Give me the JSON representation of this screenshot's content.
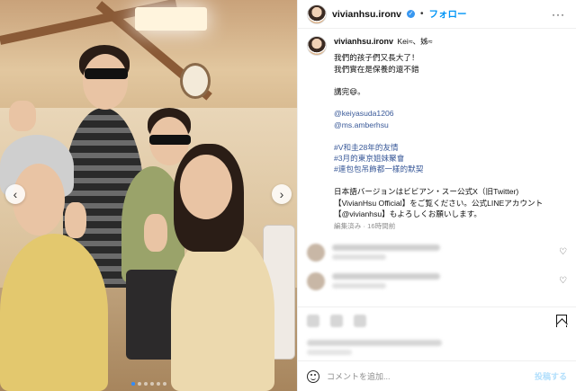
{
  "header": {
    "username": "vivianhsu.ironv",
    "separator": "•",
    "follow_label": "フォロー",
    "more_label": "···"
  },
  "photo": {
    "prev_label": "‹",
    "next_label": "›",
    "dots_count": 6,
    "active_dot": 0
  },
  "caption": {
    "username": "vivianhsu.ironv",
    "title_line": "Kei≈、姊≈",
    "lines": [
      "我們的孩子們又長大了！",
      "我們實在是保養的還不錯",
      "",
      "講完😄。",
      "",
      "@keiyasuda1206",
      "@ms.amberhsu",
      "",
      "#V和圭28年的友情",
      "#3月的東京姐妹聚會",
      "#連包包吊飾都一樣的默契",
      "",
      "日本語バージョンはビビアン・スー公式X（旧Twitter)",
      "【VivianHsu Official】をご覧ください。公式LINEアカウント",
      "【@vivianhsu】もよろしくお願いします。"
    ],
    "meta": "編集済み · 16時間前"
  },
  "comments": [
    {
      "heart": "♡"
    },
    {
      "heart": "♡"
    }
  ],
  "composer": {
    "placeholder": "コメントを追加...",
    "post_label": "投稿する"
  }
}
